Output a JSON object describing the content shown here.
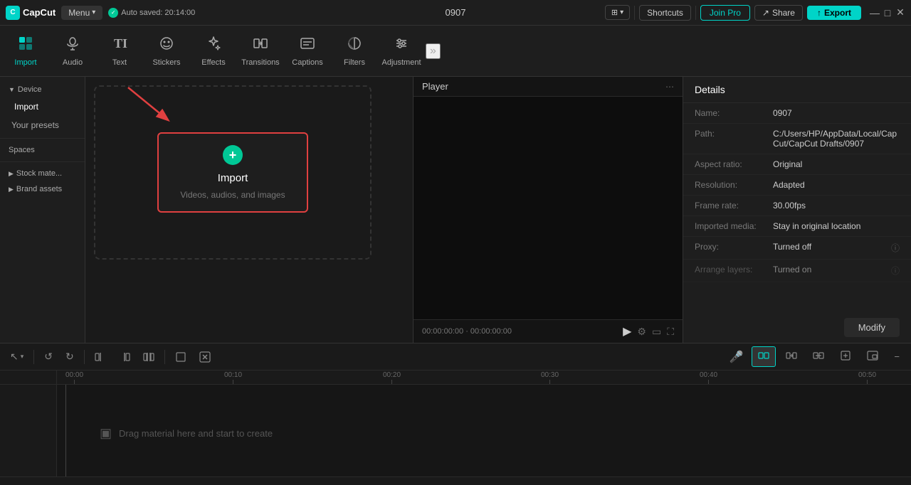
{
  "app": {
    "name": "CapCut",
    "logo_text": "C"
  },
  "topbar": {
    "menu_label": "Menu",
    "menu_arrow": "▾",
    "auto_saved": "Auto saved: 20:14:00",
    "check_icon": "✓",
    "project_name": "0907",
    "monitor_icon": "⊞",
    "shortcuts_label": "Shortcuts",
    "join_pro_label": "Join Pro",
    "share_label": "Share",
    "share_icon": "↗",
    "export_label": "Export",
    "export_icon": "↑",
    "win_minimize": "—",
    "win_maximize": "□",
    "win_close": "✕"
  },
  "toolbar": {
    "items": [
      {
        "id": "import",
        "icon": "⬇",
        "label": "Import",
        "active": true
      },
      {
        "id": "audio",
        "icon": "♪",
        "label": "Audio",
        "active": false
      },
      {
        "id": "text",
        "icon": "T",
        "label": "Text",
        "active": false
      },
      {
        "id": "stickers",
        "icon": "☺",
        "label": "Stickers",
        "active": false
      },
      {
        "id": "effects",
        "icon": "✦",
        "label": "Effects",
        "active": false
      },
      {
        "id": "transitions",
        "icon": "⇄",
        "label": "Transitions",
        "active": false
      },
      {
        "id": "captions",
        "icon": "▤",
        "label": "Captions",
        "active": false
      },
      {
        "id": "filters",
        "icon": "◑",
        "label": "Filters",
        "active": false
      },
      {
        "id": "adjustment",
        "icon": "⧖",
        "label": "Adjustment",
        "active": false
      }
    ],
    "more_icon": "»"
  },
  "sidebar": {
    "sections": [
      {
        "id": "device",
        "label": "Device",
        "has_arrow": true,
        "active": false
      },
      {
        "id": "import",
        "label": "Import",
        "active": true
      },
      {
        "id": "presets",
        "label": "Your presets",
        "active": false
      }
    ],
    "spaces_label": "Spaces",
    "stock_label": "Stock mate...",
    "brand_label": "Brand assets",
    "stock_arrow": "▶",
    "brand_arrow": "▶"
  },
  "content": {
    "import_btn_icon": "+",
    "import_btn_label": "Import",
    "import_subtitle": "Videos, audios, and images"
  },
  "player": {
    "title": "Player",
    "menu_icon": "⋯",
    "time_current": "00:00:00:00",
    "time_total": "00:00:00:00",
    "time_separator": "·",
    "play_icon": "▶",
    "settings_icon": "⚙",
    "aspect_icon": "▭",
    "fullscreen_icon": "⛶"
  },
  "details": {
    "title": "Details",
    "rows": [
      {
        "label": "Name:",
        "value": "0907"
      },
      {
        "label": "Path:",
        "value": "C:/Users/HP/AppData/Local/CapCut/CapCut Drafts/0907"
      },
      {
        "label": "Aspect ratio:",
        "value": "Original"
      },
      {
        "label": "Resolution:",
        "value": "Adapted"
      },
      {
        "label": "Frame rate:",
        "value": "30.00fps"
      },
      {
        "label": "Imported media:",
        "value": "Stay in original location"
      },
      {
        "label": "Proxy:",
        "value": "Turned off"
      },
      {
        "label": "Arrange layers:",
        "value": "Turned on"
      }
    ],
    "modify_label": "Modify"
  },
  "timeline": {
    "toolbar_btns": [
      {
        "id": "select",
        "icon": "↖",
        "has_dropdown": true
      },
      {
        "id": "undo",
        "icon": "↺"
      },
      {
        "id": "redo",
        "icon": "↻"
      },
      {
        "id": "split",
        "icon": "⧸|"
      },
      {
        "id": "split2",
        "icon": "|⧸"
      },
      {
        "id": "split3",
        "icon": "|⧸|"
      },
      {
        "id": "crop",
        "icon": "▭"
      },
      {
        "id": "delete",
        "icon": "⊞"
      }
    ],
    "mic_icon": "🎤",
    "ruler_marks": [
      "00:00",
      "00:10",
      "00:20",
      "00:30",
      "00:40",
      "00:50"
    ],
    "drag_hint": "Drag material here and start to create",
    "drag_icon": "▣",
    "right_btns": [
      {
        "id": "split-clip",
        "icon": "⊟",
        "active": true
      },
      {
        "id": "transition",
        "icon": "⧖"
      },
      {
        "id": "clip-vol",
        "icon": "⊟"
      },
      {
        "id": "clip-zoom",
        "icon": "⊞"
      },
      {
        "id": "pip",
        "icon": "⊡"
      },
      {
        "id": "zoom-out",
        "icon": "−"
      }
    ]
  }
}
